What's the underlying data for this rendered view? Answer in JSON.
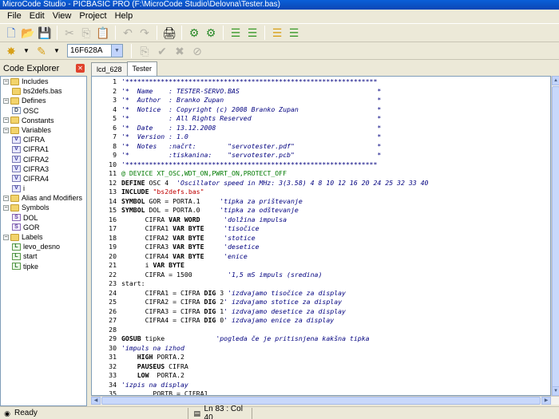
{
  "window": {
    "title": "MicroCode Studio - PICBASIC PRO (F:\\MicroCode Studio\\Delovna\\Tester.bas)"
  },
  "menu": [
    "File",
    "Edit",
    "View",
    "Project",
    "Help"
  ],
  "toolbar": {
    "icons": [
      "new-file-icon",
      "open-folder-icon",
      "save-icon",
      "cut-icon",
      "copy-icon",
      "paste-icon",
      "undo-icon",
      "redo-icon",
      "print-icon",
      "compile-icon",
      "compile-program-icon",
      "indent-icon",
      "outdent-icon",
      "comment-icon",
      "uncomment-icon"
    ],
    "device": "16F628A"
  },
  "explorer": {
    "title": "Code Explorer",
    "items": [
      {
        "label": "Includes",
        "kind": "folder",
        "level": 0
      },
      {
        "label": "bs2defs.bas",
        "kind": "folder",
        "level": 1
      },
      {
        "label": "Defines",
        "kind": "folder",
        "level": 0
      },
      {
        "label": "OSC",
        "kind": "define",
        "level": 1
      },
      {
        "label": "Constants",
        "kind": "folder",
        "level": 0
      },
      {
        "label": "Variables",
        "kind": "folder",
        "level": 0
      },
      {
        "label": "CIFRA",
        "kind": "var",
        "level": 1
      },
      {
        "label": "CIFRA1",
        "kind": "var",
        "level": 1
      },
      {
        "label": "CIFRA2",
        "kind": "var",
        "level": 1
      },
      {
        "label": "CIFRA3",
        "kind": "var",
        "level": 1
      },
      {
        "label": "CIFRA4",
        "kind": "var",
        "level": 1
      },
      {
        "label": "i",
        "kind": "var",
        "level": 1
      },
      {
        "label": "Alias and Modifiers",
        "kind": "folder",
        "level": 0
      },
      {
        "label": "Symbols",
        "kind": "folder",
        "level": 0
      },
      {
        "label": "DOL",
        "kind": "symbol",
        "level": 1
      },
      {
        "label": "GOR",
        "kind": "symbol",
        "level": 1
      },
      {
        "label": "Labels",
        "kind": "folder",
        "level": 0
      },
      {
        "label": "levo_desno",
        "kind": "label",
        "level": 1
      },
      {
        "label": "start",
        "kind": "label",
        "level": 1
      },
      {
        "label": "tipke",
        "kind": "label",
        "level": 1
      }
    ]
  },
  "tabs": [
    {
      "label": "lcd_628",
      "active": false
    },
    {
      "label": "Tester",
      "active": true
    }
  ],
  "editor": {
    "lines": [
      {
        "n": "1",
        "parts": [
          [
            "cmt",
            "'****************************************************************"
          ]
        ]
      },
      {
        "n": "2",
        "parts": [
          [
            "cmt",
            "'*  Name    : TESTER-SERVO.BAS                                   *"
          ]
        ]
      },
      {
        "n": "3",
        "parts": [
          [
            "cmt",
            "'*  Author  : Branko Zupan                                       *"
          ]
        ]
      },
      {
        "n": "4",
        "parts": [
          [
            "cmt",
            "'*  Notice  : Copyright (c) 2008 Branko Zupan                    *"
          ]
        ]
      },
      {
        "n": "5",
        "parts": [
          [
            "cmt",
            "'*          : All Rights Reserved                                *"
          ]
        ]
      },
      {
        "n": "6",
        "parts": [
          [
            "cmt",
            "'*  Date    : 13.12.2008                                         *"
          ]
        ]
      },
      {
        "n": "7",
        "parts": [
          [
            "cmt",
            "'*  Version : 1.0                                                *"
          ]
        ]
      },
      {
        "n": "8",
        "parts": [
          [
            "cmt",
            "'*  Notes   :načrt:        \"servotester.pdf\"                     *"
          ]
        ]
      },
      {
        "n": "9",
        "parts": [
          [
            "cmt",
            "'*          :tiskanina:    \"servotester.pcb\"                     *"
          ]
        ]
      },
      {
        "n": "10",
        "parts": [
          [
            "cmt",
            "'****************************************************************"
          ]
        ]
      },
      {
        "n": "11",
        "parts": [
          [
            "dir",
            "@ DEVICE XT_OSC,WDT_ON,PWRT_ON,PROTECT_OFF"
          ]
        ]
      },
      {
        "n": "12",
        "parts": [
          [
            "kw",
            "DEFINE"
          ],
          [
            "plain",
            " OSC 4  "
          ],
          [
            "cmt",
            "'Oscillator speed in MHz: 3(3.58) 4 8 10 12 16 20 24 25 32 33 40"
          ]
        ]
      },
      {
        "n": "13",
        "parts": [
          [
            "kw",
            "INCLUDE"
          ],
          [
            "plain",
            " "
          ],
          [
            "str",
            "\"bs2defs.bas\""
          ]
        ]
      },
      {
        "n": "14",
        "parts": [
          [
            "kw",
            "SYMBOL"
          ],
          [
            "plain",
            " GOR = PORTA.1     "
          ],
          [
            "cmt",
            "'tipka za prištevanje"
          ]
        ]
      },
      {
        "n": "15",
        "parts": [
          [
            "kw",
            "SYMBOL"
          ],
          [
            "plain",
            " DOL = PORTA.0     "
          ],
          [
            "cmt",
            "'tipka za odštevanje"
          ]
        ]
      },
      {
        "n": "16",
        "parts": [
          [
            "plain",
            "      CIFRA "
          ],
          [
            "kw",
            "VAR WORD"
          ],
          [
            "plain",
            "      "
          ],
          [
            "cmt",
            "'dolžina impulsa"
          ]
        ]
      },
      {
        "n": "17",
        "parts": [
          [
            "plain",
            "      CIFRA1 "
          ],
          [
            "kw",
            "VAR BYTE"
          ],
          [
            "plain",
            "     "
          ],
          [
            "cmt",
            "'tisočice"
          ]
        ]
      },
      {
        "n": "18",
        "parts": [
          [
            "plain",
            "      CIFRA2 "
          ],
          [
            "kw",
            "VAR BYTE"
          ],
          [
            "plain",
            "     "
          ],
          [
            "cmt",
            "'stotice"
          ]
        ]
      },
      {
        "n": "19",
        "parts": [
          [
            "plain",
            "      CIFRA3 "
          ],
          [
            "kw",
            "VAR BYTE"
          ],
          [
            "plain",
            "     "
          ],
          [
            "cmt",
            "'desetice"
          ]
        ]
      },
      {
        "n": "20",
        "parts": [
          [
            "plain",
            "      CIFRA4 "
          ],
          [
            "kw",
            "VAR BYTE"
          ],
          [
            "plain",
            "     "
          ],
          [
            "cmt",
            "'enice"
          ]
        ]
      },
      {
        "n": "21",
        "parts": [
          [
            "plain",
            "      i "
          ],
          [
            "kw",
            "VAR BYTE"
          ]
        ]
      },
      {
        "n": "22",
        "parts": [
          [
            "plain",
            "      CIFRA = 1500         "
          ],
          [
            "cmt",
            "'1,5 mS impuls (sredina)"
          ]
        ]
      },
      {
        "n": "23",
        "parts": [
          [
            "plain",
            "start:"
          ]
        ]
      },
      {
        "n": "24",
        "parts": [
          [
            "plain",
            "      CIFRA1 = CIFRA "
          ],
          [
            "kw",
            "DIG"
          ],
          [
            "plain",
            " 3 "
          ],
          [
            "cmt",
            "'izdvajamo tisočice za display"
          ]
        ]
      },
      {
        "n": "25",
        "parts": [
          [
            "plain",
            "      CIFRA2 = CIFRA "
          ],
          [
            "kw",
            "DIG"
          ],
          [
            "plain",
            " 2"
          ],
          [
            "cmt",
            "' izdvajamo stotice za display"
          ]
        ]
      },
      {
        "n": "26",
        "parts": [
          [
            "plain",
            "      CIFRA3 = CIFRA "
          ],
          [
            "kw",
            "DIG"
          ],
          [
            "plain",
            " 1"
          ],
          [
            "cmt",
            "' izdvajamo desetice za display"
          ]
        ]
      },
      {
        "n": "27",
        "parts": [
          [
            "plain",
            "      CIFRA4 = CIFRA "
          ],
          [
            "kw",
            "DIG"
          ],
          [
            "plain",
            " 0"
          ],
          [
            "cmt",
            "' izdvajamo enice za display"
          ]
        ]
      },
      {
        "n": "28",
        "parts": []
      },
      {
        "n": "29",
        "parts": [
          [
            "kw",
            "GOSUB"
          ],
          [
            "plain",
            " tipke             "
          ],
          [
            "cmt",
            "'pogleda če je pritisnjena kakšna tipka"
          ]
        ]
      },
      {
        "n": "30",
        "parts": [
          [
            "cmt",
            "'impuls na izhod"
          ]
        ]
      },
      {
        "n": "31",
        "parts": [
          [
            "plain",
            "    "
          ],
          [
            "kw",
            "HIGH"
          ],
          [
            "plain",
            " PORTA.2"
          ]
        ]
      },
      {
        "n": "32",
        "parts": [
          [
            "plain",
            "    "
          ],
          [
            "kw",
            "PAUSEUS"
          ],
          [
            "plain",
            " CIFRA"
          ]
        ]
      },
      {
        "n": "33",
        "parts": [
          [
            "plain",
            "    "
          ],
          [
            "kw",
            "LOW"
          ],
          [
            "plain",
            "  PORTA.2"
          ]
        ]
      },
      {
        "n": "34",
        "parts": [
          [
            "cmt",
            "'izpis na display"
          ]
        ]
      },
      {
        "n": "35",
        "parts": [
          [
            "plain",
            "        PORTB = CIFRA1"
          ]
        ]
      }
    ]
  },
  "status": {
    "ready": "Ready",
    "position": "Ln 83 : Col 40"
  }
}
